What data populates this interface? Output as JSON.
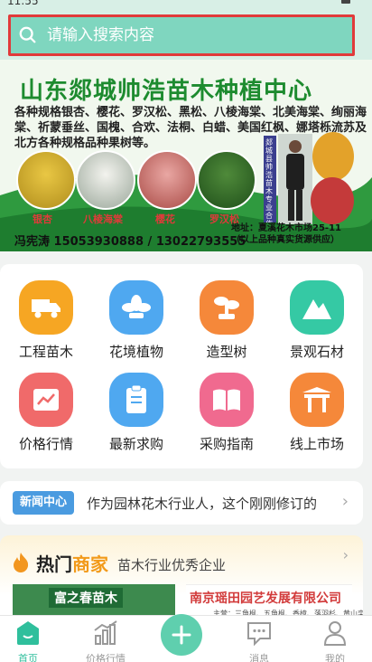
{
  "status": {
    "time": "11:55"
  },
  "search": {
    "placeholder": "请输入搜索内容"
  },
  "banner": {
    "title": "山东郯城帅浩苗木种植中心",
    "description": "各种规格银杏、樱花、罗汉松、黑松、八棱海棠、北美海棠、绚丽海棠、祈蒙垂丝、国槐、合欢、法桐、白蜡、美国红枫、娜塔栎流苏及北方各种规格品种果树等。",
    "trees": [
      "银杏",
      "八棱海棠",
      "樱花",
      "罗汉松"
    ],
    "phone": "冯宪涛 15053930888 / 13022793555",
    "address_line1": "地址：夏溪花木市场25-11",
    "address_line2": "（以上品种真实货源供应）",
    "vertical_text": "郯城县帅浩苗木专业合作社"
  },
  "categories": [
    {
      "label": "工程苗木",
      "icon": "truck-icon",
      "color": "#f6a623"
    },
    {
      "label": "花境植物",
      "icon": "flower-icon",
      "color": "#4fa8f0"
    },
    {
      "label": "造型树",
      "icon": "bonsai-icon",
      "color": "#f5883a"
    },
    {
      "label": "景观石材",
      "icon": "mountain-icon",
      "color": "#35c9a4"
    },
    {
      "label": "价格行情",
      "icon": "chart-icon",
      "color": "#f06a6a"
    },
    {
      "label": "最新求购",
      "icon": "clipboard-icon",
      "color": "#4fa8f0"
    },
    {
      "label": "采购指南",
      "icon": "book-icon",
      "color": "#f06a8f"
    },
    {
      "label": "线上市场",
      "icon": "gate-icon",
      "color": "#f5883a"
    }
  ],
  "news": {
    "badge": "新闻中心",
    "headline": "作为园林花木行业人，这个刚刚修订的"
  },
  "hot": {
    "title_prefix": "热门",
    "title_accent": "商家",
    "subtitle": "苗木行业优秀企业",
    "ad1_title": "富之春苗木",
    "ad2_title": "南京瑶田园艺发展有限公司",
    "ad2_sub": "主营：三角枫、五角枫、香樟、落羽杉、黄山栾树、"
  },
  "tabbar": {
    "home": "首页",
    "price": "价格行情",
    "message": "消息",
    "mine": "我的"
  }
}
